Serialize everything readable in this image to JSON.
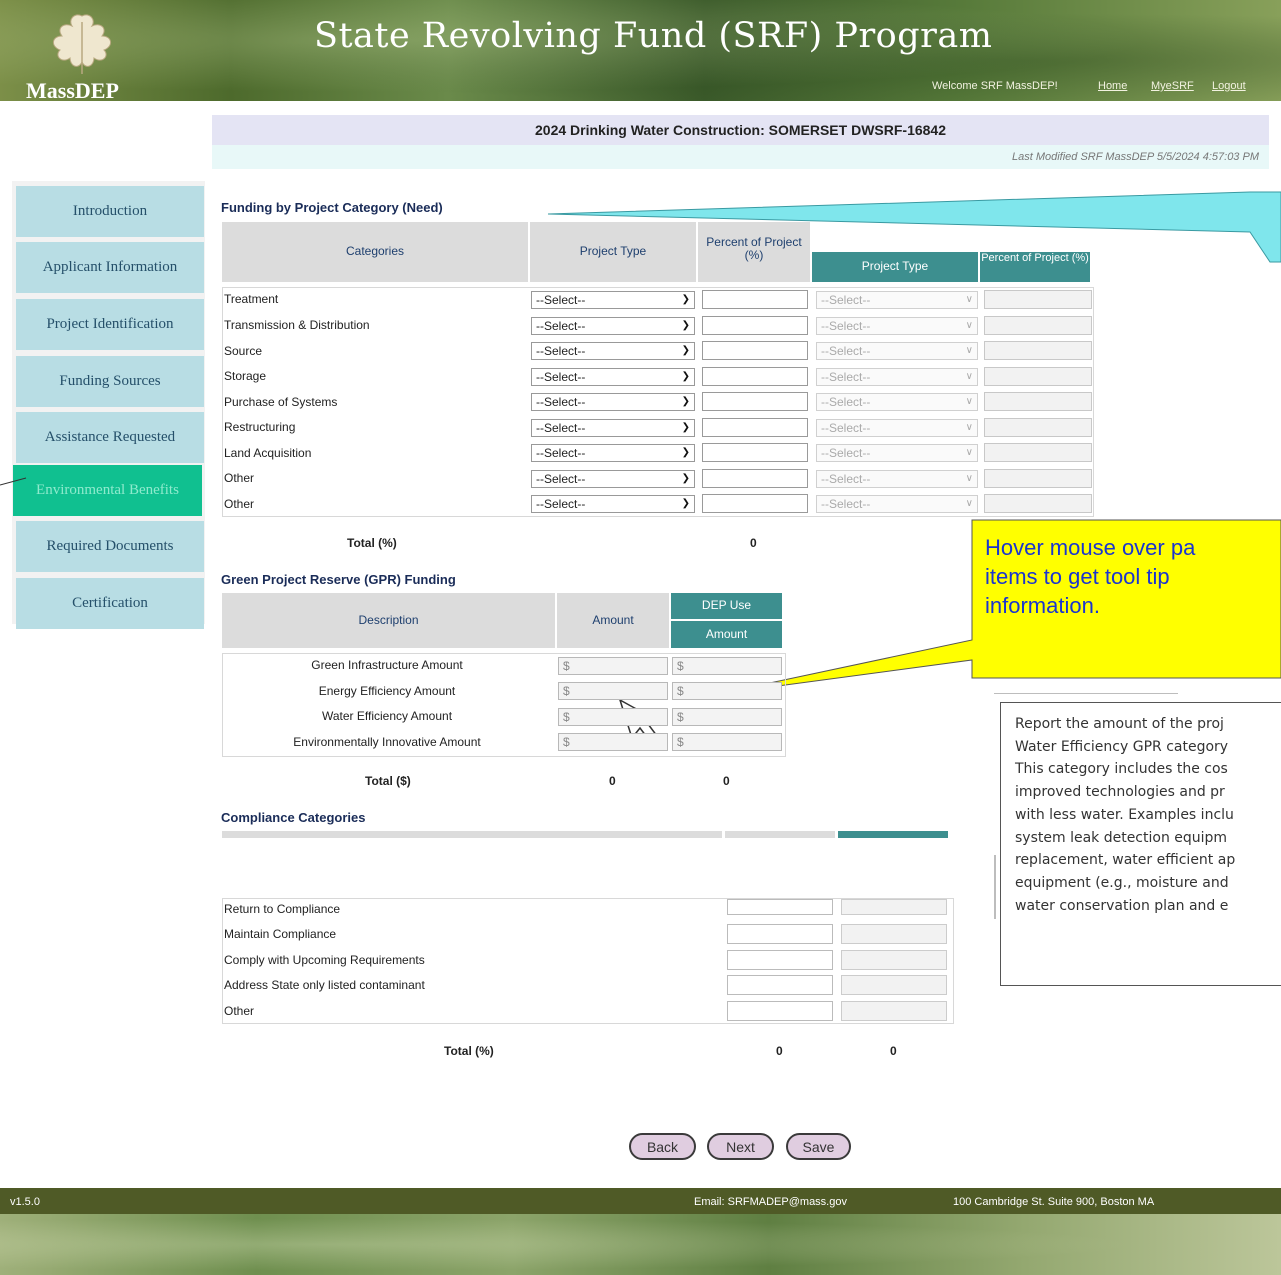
{
  "header": {
    "app_title": "State Revolving Fund (SRF) Program",
    "org_label": "MassDEP",
    "welcome_text": "Welcome SRF MassDEP!",
    "links": {
      "home": "Home",
      "myesrf": "MyeSRF",
      "logout": "Logout"
    }
  },
  "page": {
    "title": "2024 Drinking Water Construction: SOMERSET DWSRF-16842",
    "last_modified": "Last Modified SRF MassDEP 5/5/2024 4:57:03 PM"
  },
  "sidebar": {
    "items": [
      {
        "label": "Introduction"
      },
      {
        "label": "Applicant Information"
      },
      {
        "label": "Project Identification"
      },
      {
        "label": "Funding Sources"
      },
      {
        "label": "Assistance Requested"
      },
      {
        "label": "Environmental Benefits",
        "active": true
      },
      {
        "label": "Required Documents"
      },
      {
        "label": "Certification"
      }
    ]
  },
  "funding": {
    "title": "Funding by Project Category (Need)",
    "headers": {
      "categories": "Categories",
      "project_type": "Project Type",
      "percent": "Percent of Project (%)",
      "dep_project_type": "Project Type",
      "dep_percent": "Percent of Project (%)"
    },
    "rows": [
      {
        "label": "Treatment",
        "select": "--Select--",
        "dep_select": "--Select--"
      },
      {
        "label": "Transmission & Distribution",
        "select": "--Select--",
        "dep_select": "--Select--"
      },
      {
        "label": "Source",
        "select": "--Select--",
        "dep_select": "--Select--"
      },
      {
        "label": "Storage",
        "select": "--Select--",
        "dep_select": "--Select--"
      },
      {
        "label": "Purchase of Systems",
        "select": "--Select--",
        "dep_select": "--Select--"
      },
      {
        "label": "Restructuring",
        "select": "--Select--",
        "dep_select": "--Select--"
      },
      {
        "label": "Land Acquisition",
        "select": "--Select--",
        "dep_select": "--Select--"
      },
      {
        "label": "Other",
        "select": "--Select--",
        "dep_select": "--Select--"
      },
      {
        "label": "Other",
        "select": "--Select--",
        "dep_select": "--Select--"
      }
    ],
    "total_label": "Total (%)",
    "total_value": "0"
  },
  "gpr": {
    "title": "Green Project Reserve (GPR) Funding",
    "headers": {
      "description": "Description",
      "amount": "Amount",
      "dep_use": "DEP Use",
      "dep_amount": "Amount"
    },
    "rows": [
      {
        "label": "Green Infrastructure Amount",
        "prefix": "$"
      },
      {
        "label": "Energy Efficiency Amount",
        "prefix": "$"
      },
      {
        "label": "Water Efficiency Amount",
        "prefix": "$"
      },
      {
        "label": "Environmentally Innovative Amount",
        "prefix": "$"
      }
    ],
    "total_label": "Total ($)",
    "total_amount": "0",
    "total_dep": "0"
  },
  "compliance": {
    "title": "Compliance Categories",
    "rows": [
      {
        "label": "Return to Compliance"
      },
      {
        "label": "Maintain Compliance"
      },
      {
        "label": "Comply with Upcoming Requirements"
      },
      {
        "label": "Address State only listed contaminant"
      },
      {
        "label": "Other"
      }
    ],
    "total_label": "Total (%)",
    "total_value": "0",
    "total_dep": "0"
  },
  "hover_callout": {
    "lines": [
      "Hover mouse over pa",
      "items to get tool tip",
      "information."
    ]
  },
  "tooltip": {
    "lines": [
      "Report the amount of the proj",
      "Water Efficiency GPR category",
      "This category includes the cos",
      "improved technologies and pr",
      "with less water. Examples inclu",
      "system leak detection equipm",
      "replacement, water efficient ap",
      "equipment (e.g., moisture and",
      "water conservation plan and e"
    ]
  },
  "buttons": {
    "back": "Back",
    "next": "Next",
    "save": "Save"
  },
  "footer": {
    "version": "v1.5.0",
    "email": "Email: SRFMADEP@mass.gov",
    "address": "100 Cambridge St. Suite 900, Boston MA"
  },
  "colors": {
    "nav_inactive": "#b8dde4",
    "nav_active": "#10c090",
    "callout_teal": "#7fe6ec",
    "callout_yellow": "#ffff00",
    "header_teal": "#3d8f8f",
    "button_bg": "#e0cde0"
  }
}
